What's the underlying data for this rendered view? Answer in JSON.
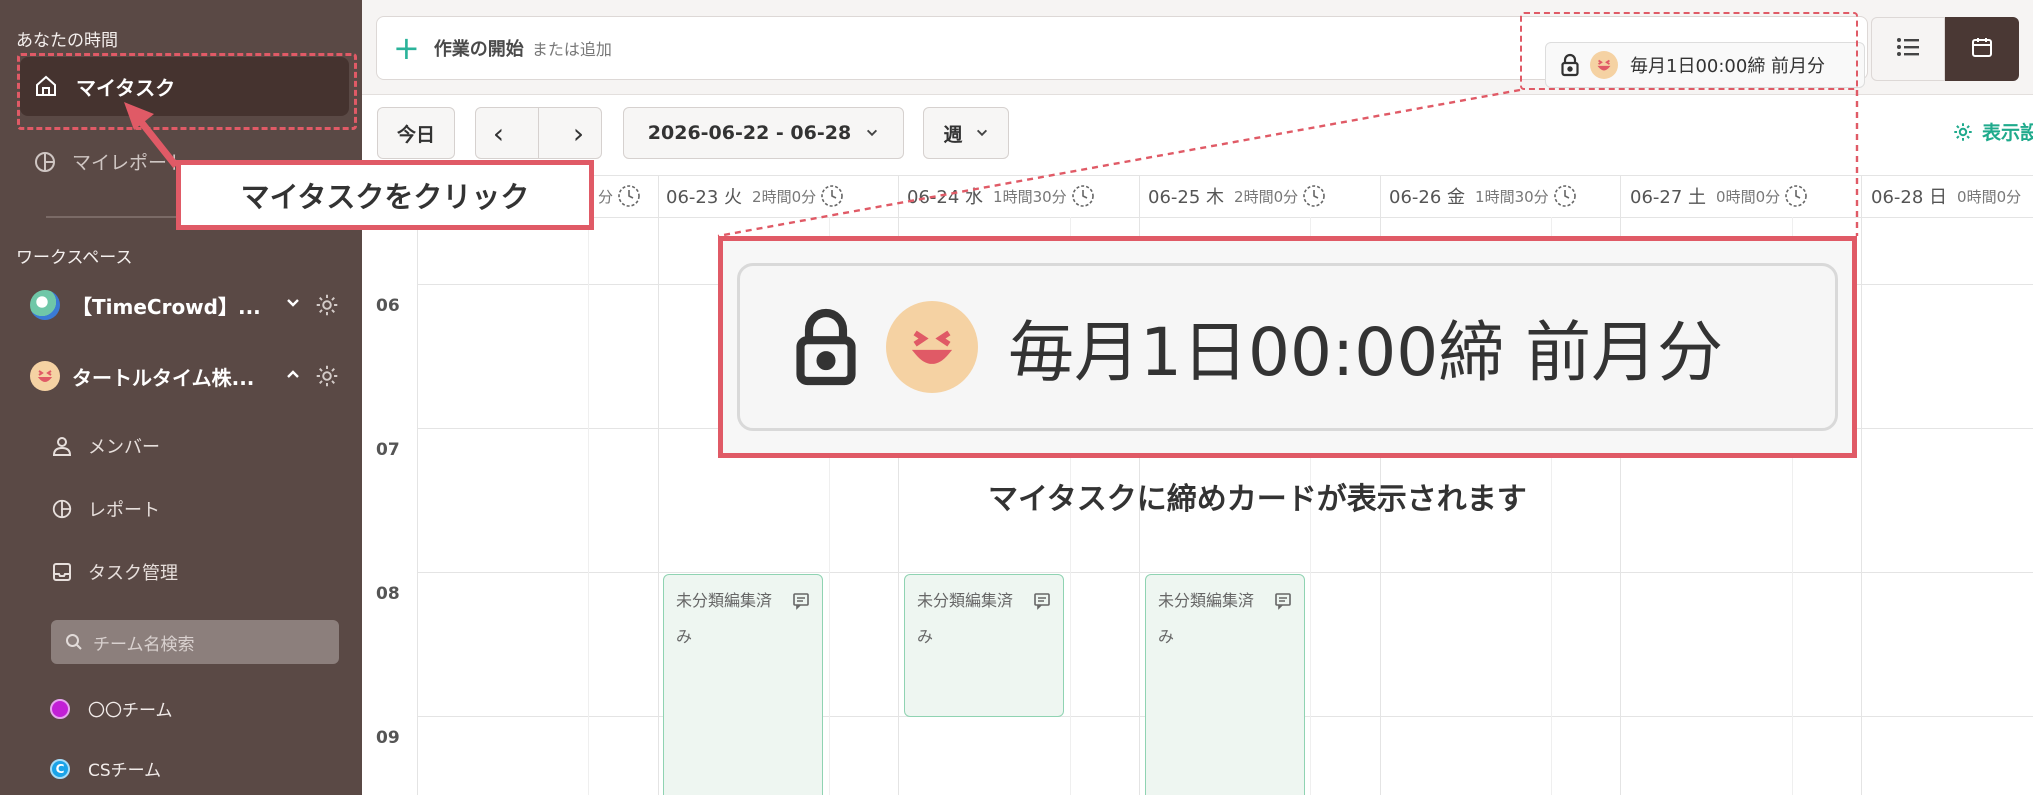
{
  "sidebar": {
    "your_time_label": "あなたの時間",
    "my_tasks": "マイタスク",
    "my_report": "マイレポート",
    "workspace_label": "ワークスペース",
    "workspaces": [
      {
        "name": "【TimeCrowd】..."
      },
      {
        "name": "タートルタイム株..."
      }
    ],
    "sub_items": [
      "メンバー",
      "レポート",
      "タスク管理"
    ],
    "team_search_placeholder": "チーム名検索",
    "teams": [
      {
        "name": "〇〇チーム",
        "color": "#c21fd6"
      },
      {
        "name": "CSチーム",
        "color": "#1aa3e8",
        "letter": "C"
      }
    ]
  },
  "header": {
    "start_task_label": "作業の開始",
    "start_task_hint": "または追加",
    "closing_text": "毎月1日00:00締 前月分"
  },
  "toolbar": {
    "today": "今日",
    "prev": "‹",
    "next": "›",
    "date_range": "2026-06-22 - 06-28",
    "view_mode": "週",
    "display_settings": "表示設定"
  },
  "calendar": {
    "days": [
      {
        "label": "",
        "hours": "分"
      },
      {
        "label": "06-23 火",
        "hours": "2時間0分"
      },
      {
        "label": "06-24 水",
        "hours": "1時間30分"
      },
      {
        "label": "06-25 木",
        "hours": "2時間0分"
      },
      {
        "label": "06-26 金",
        "hours": "1時間30分"
      },
      {
        "label": "06-27 土",
        "hours": "0時間0分"
      },
      {
        "label": "06-28 日",
        "hours": "0時間0分"
      }
    ],
    "hours": [
      "06",
      "07",
      "08",
      "09"
    ],
    "events": [
      {
        "title": "未分類編集済",
        "title2": "み"
      },
      {
        "title": "未分類編集済",
        "title2": "み"
      },
      {
        "title": "未分類編集済",
        "title2": "み"
      }
    ]
  },
  "annotations": {
    "click_callout": "マイタスクをクリック",
    "zoom_text": "毎月1日00:00締 前月分",
    "zoom_note": "マイタスクに締めカードが表示されます"
  },
  "colors": {
    "sidebar": "#5a4945",
    "accent": "#2bb39a",
    "highlight": "#e05a66"
  }
}
